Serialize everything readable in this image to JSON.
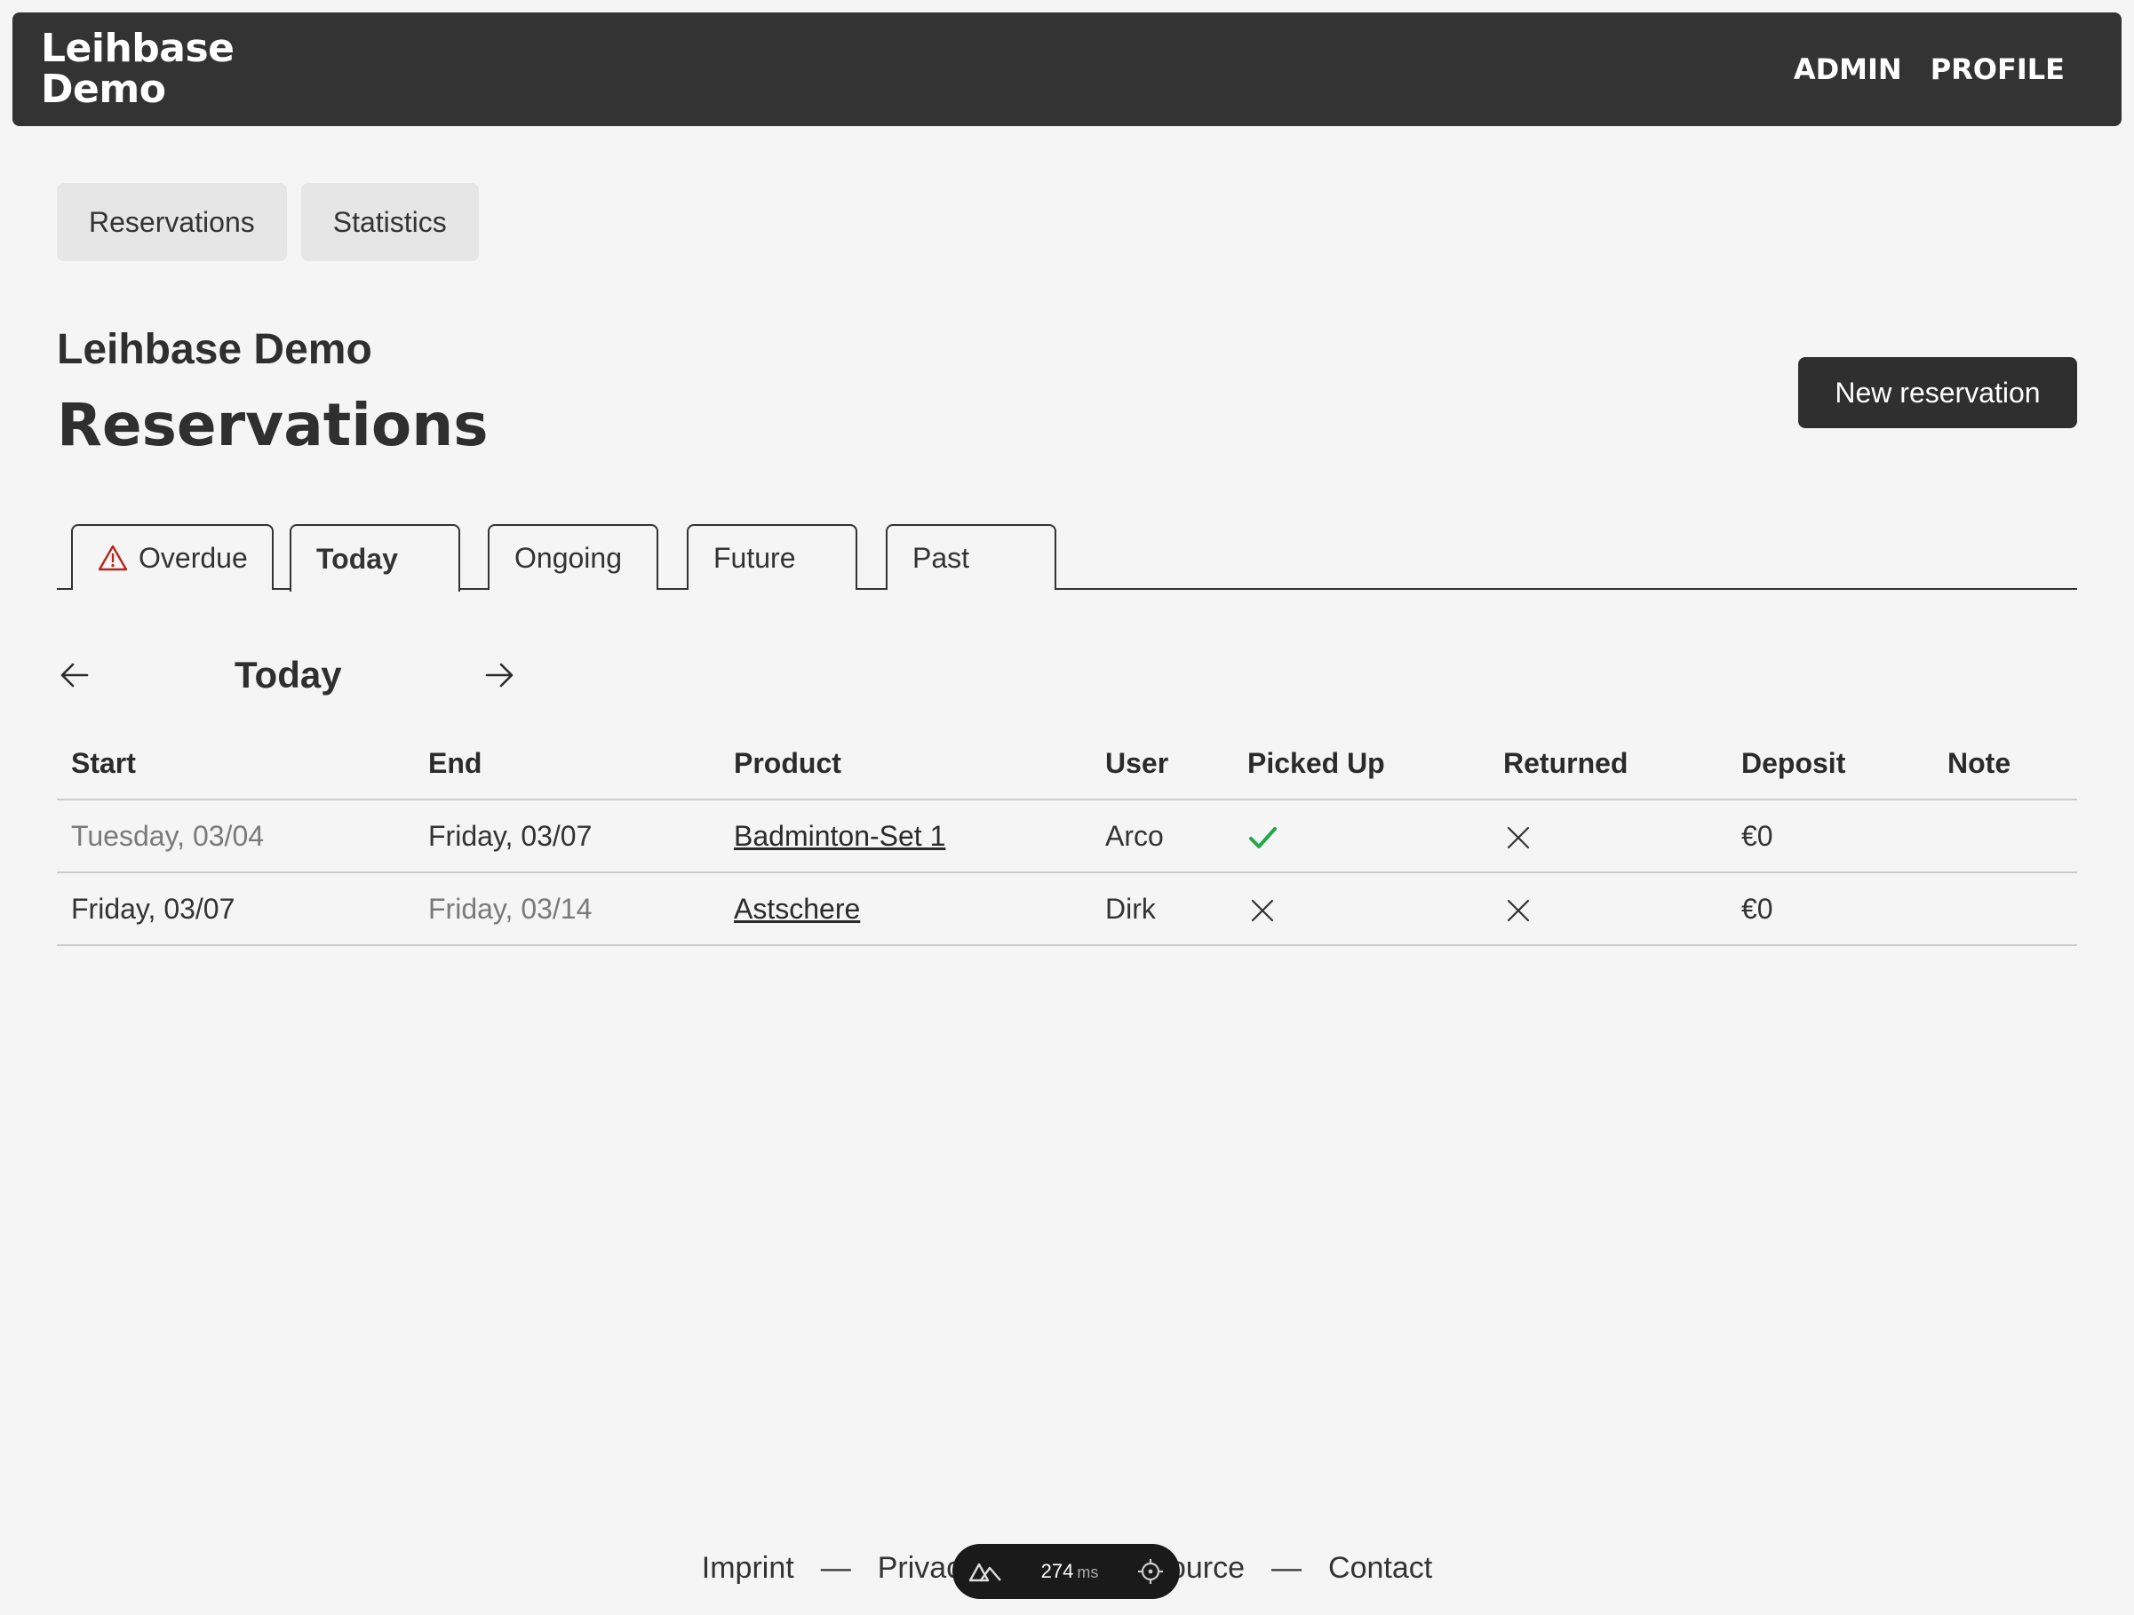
{
  "header": {
    "brand": "Leihbase Demo",
    "nav": [
      "ADMIN",
      "PROFILE"
    ]
  },
  "subnav": [
    "Reservations",
    "Statistics"
  ],
  "page": {
    "org": "Leihbase Demo",
    "title": "Reservations",
    "new_button": "New reservation"
  },
  "tabs": [
    "Overdue",
    "Today",
    "Ongoing",
    "Future",
    "Past"
  ],
  "active_tab": "Today",
  "day_nav": {
    "label": "Today"
  },
  "table": {
    "headers": [
      "Start",
      "End",
      "Product",
      "User",
      "Picked Up",
      "Returned",
      "Deposit",
      "Note"
    ],
    "rows": [
      {
        "start": "Tuesday, 03/04",
        "end": "Friday, 03/07",
        "product": "Badminton-Set 1",
        "user": "Arco",
        "picked_up": true,
        "returned": false,
        "deposit": "€0",
        "note": ""
      },
      {
        "start": "Friday, 03/07",
        "end": "Friday, 03/14",
        "product": "Astschere",
        "user": "Dirk",
        "picked_up": false,
        "returned": false,
        "deposit": "€0",
        "note": ""
      }
    ]
  },
  "footer": {
    "links": [
      "Imprint",
      "Privacy Policy",
      "Source",
      "Contact"
    ],
    "separator": "—"
  },
  "devtools": {
    "time": "274",
    "unit": "ms"
  },
  "colors": {
    "topbar": "#333333",
    "check": "#22a84a",
    "warning": "#b3261e"
  }
}
